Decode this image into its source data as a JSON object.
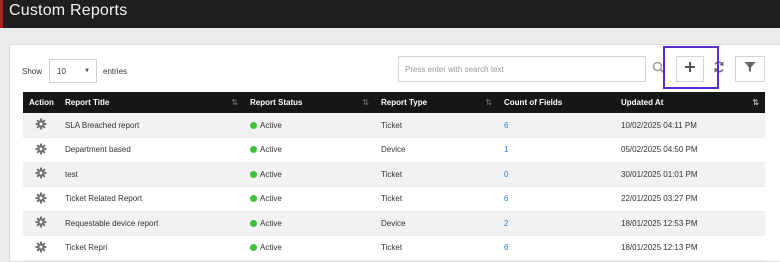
{
  "header": {
    "title": "Custom Reports"
  },
  "controls": {
    "show_label": "Show",
    "page_size": "10",
    "entries_label": "entries",
    "search_placeholder": "Press enter with search text"
  },
  "colors": {
    "status_active": "#3dc43d",
    "link": "#2a7ad6",
    "highlight": "#5b2ccf",
    "header_bg": "#161616"
  },
  "table": {
    "columns": [
      "Action",
      "Report Title",
      "Report Status",
      "Report Type",
      "Count of Fields",
      "Updated At"
    ],
    "rows": [
      {
        "title": "SLA Breached report",
        "status": "Active",
        "type": "Ticket",
        "count": "6",
        "updated": "10/02/2025 04:11 PM"
      },
      {
        "title": "Department based",
        "status": "Active",
        "type": "Device",
        "count": "1",
        "updated": "05/02/2025 04:50 PM"
      },
      {
        "title": "test",
        "status": "Active",
        "type": "Ticket",
        "count": "0",
        "updated": "30/01/2025 01:01 PM"
      },
      {
        "title": "Ticket Related Report",
        "status": "Active",
        "type": "Ticket",
        "count": "6",
        "updated": "22/01/2025 03:27 PM"
      },
      {
        "title": "Requestable device report",
        "status": "Active",
        "type": "Device",
        "count": "2",
        "updated": "18/01/2025 12:53 PM"
      },
      {
        "title": "Ticket Repri",
        "status": "Active",
        "type": "Ticket",
        "count": "6",
        "updated": "18/01/2025 12:13 PM"
      }
    ]
  },
  "icons": {
    "action": "gear-icon",
    "add": "plus-icon",
    "refresh": "refresh-icon",
    "filter": "filter-icon",
    "search": "search-icon"
  }
}
